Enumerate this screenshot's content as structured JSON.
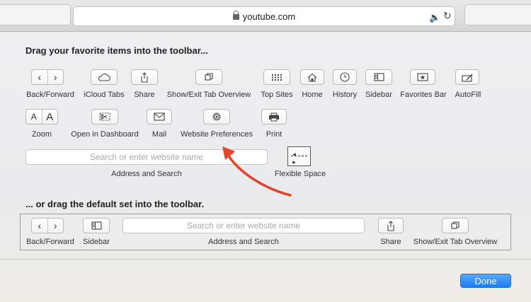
{
  "browser": {
    "url": "youtube.com"
  },
  "customize": {
    "favorites_heading": "Drag your favorite items into the toolbar...",
    "items_row1": [
      {
        "label": "Back/Forward",
        "icon": "chevrons-icon"
      },
      {
        "label": "iCloud Tabs",
        "icon": "cloud-icon"
      },
      {
        "label": "Share",
        "icon": "share-icon"
      },
      {
        "label": "Show/Exit Tab Overview",
        "icon": "tab-overview-icon"
      },
      {
        "label": "Top Sites",
        "icon": "grid-icon"
      },
      {
        "label": "Home",
        "icon": "house-icon"
      },
      {
        "label": "History",
        "icon": "clock-icon"
      },
      {
        "label": "Sidebar",
        "icon": "sidebar-icon"
      },
      {
        "label": "Favorites Bar",
        "icon": "star-icon"
      },
      {
        "label": "AutoFill",
        "icon": "pencil-icon"
      }
    ],
    "items_row2": [
      {
        "label": "Zoom",
        "glyph_small": "A",
        "glyph_large": "A"
      },
      {
        "label": "Open in Dashboard",
        "icon": "scissors-icon"
      },
      {
        "label": "Mail",
        "icon": "envelope-icon"
      },
      {
        "label": "Website Preferences",
        "icon": "gear-icon"
      },
      {
        "label": "Print",
        "icon": "printer-icon"
      }
    ],
    "search_placeholder": "Search or enter website name",
    "address_label": "Address and Search",
    "flexible_space_label": "Flexible Space",
    "default_heading": "... or drag the default set into the toolbar.",
    "default_set": {
      "back_forward": "Back/Forward",
      "sidebar": "Sidebar",
      "address": "Address and Search",
      "share": "Share",
      "tab_overview": "Show/Exit Tab Overview",
      "search_placeholder": "Search or enter website name"
    },
    "done_label": "Done"
  },
  "colors": {
    "accent": "#1b7ef5",
    "arrow": "#e8442a"
  }
}
